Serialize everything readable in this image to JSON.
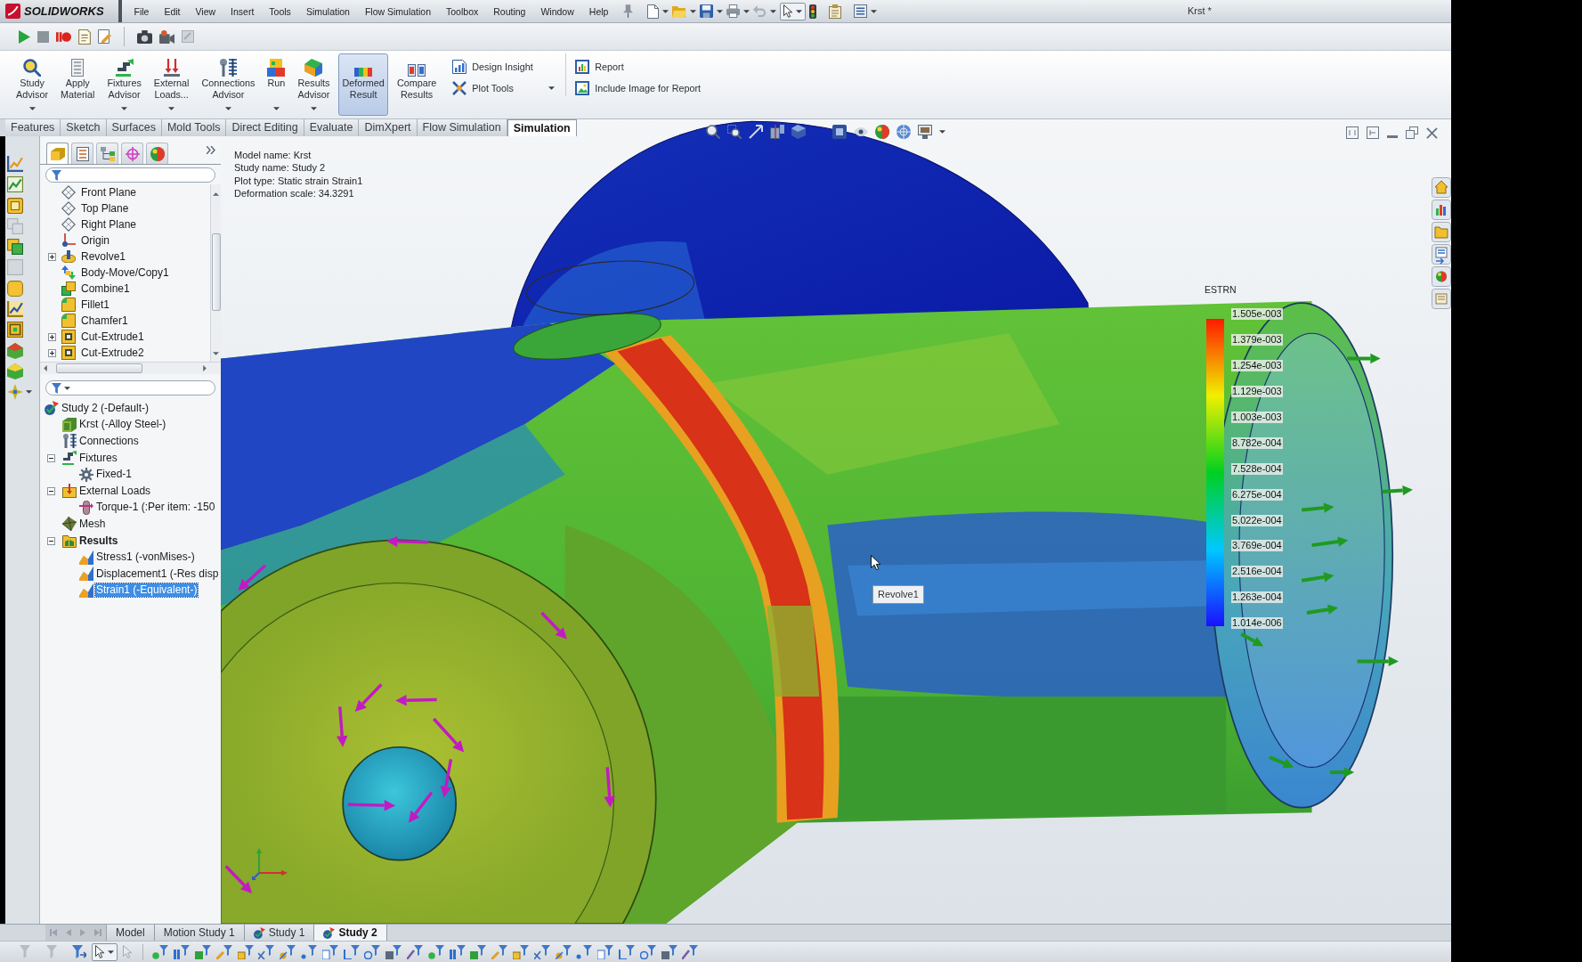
{
  "window": {
    "app_name": "SOLIDWORKS",
    "title": "Krst *"
  },
  "menu": [
    "File",
    "Edit",
    "View",
    "Insert",
    "Tools",
    "Simulation",
    "Flow Simulation",
    "Toolbox",
    "Routing",
    "Window",
    "Help"
  ],
  "command_manager": {
    "large_buttons": [
      {
        "label": "Study Advisor",
        "has_menu": true,
        "selected": false
      },
      {
        "label": "Apply Material",
        "has_menu": false,
        "selected": false
      },
      {
        "label": "Fixtures Advisor",
        "has_menu": true,
        "selected": false
      },
      {
        "label": "External Loads...",
        "has_menu": true,
        "selected": false
      },
      {
        "label": "Connections Advisor",
        "has_menu": true,
        "selected": false
      },
      {
        "label": "Run",
        "has_menu": true,
        "selected": false
      },
      {
        "label": "Results Advisor",
        "has_menu": true,
        "selected": false
      },
      {
        "label": "Deformed Result",
        "has_menu": false,
        "selected": true
      },
      {
        "label": "Compare Results",
        "has_menu": false,
        "selected": false
      }
    ],
    "small_groups": [
      [
        {
          "label": "Design Insight",
          "has_menu": false
        },
        {
          "label": "Plot Tools",
          "has_menu": true
        }
      ],
      [
        {
          "label": "Report",
          "has_menu": false
        },
        {
          "label": "Include Image for Report",
          "has_menu": false
        }
      ]
    ]
  },
  "tabs": [
    {
      "label": "Features",
      "selected": false
    },
    {
      "label": "Sketch",
      "selected": false
    },
    {
      "label": "Surfaces",
      "selected": false
    },
    {
      "label": "Mold Tools",
      "selected": false
    },
    {
      "label": "Direct Editing",
      "selected": false
    },
    {
      "label": "Evaluate",
      "selected": false
    },
    {
      "label": "DimXpert",
      "selected": false
    },
    {
      "label": "Flow Simulation",
      "selected": false
    },
    {
      "label": "Simulation",
      "selected": true
    }
  ],
  "panel_tabs": [
    {
      "kind": "features",
      "selected": true
    },
    {
      "kind": "properties",
      "selected": false
    },
    {
      "kind": "configurations",
      "selected": false
    },
    {
      "kind": "dimxpert",
      "selected": false
    },
    {
      "kind": "display",
      "selected": false
    }
  ],
  "feature_tree": [
    {
      "label": "Front Plane",
      "kind": "plane"
    },
    {
      "label": "Top Plane",
      "kind": "plane"
    },
    {
      "label": "Right Plane",
      "kind": "plane"
    },
    {
      "label": "Origin",
      "kind": "origin"
    },
    {
      "label": "Revolve1",
      "kind": "revolve",
      "expanded": false
    },
    {
      "label": "Body-Move/Copy1",
      "kind": "move"
    },
    {
      "label": "Combine1",
      "kind": "combine"
    },
    {
      "label": "Fillet1",
      "kind": "fillet"
    },
    {
      "label": "Chamfer1",
      "kind": "fillet"
    },
    {
      "label": "Cut-Extrude1",
      "kind": "cut",
      "expanded": false
    },
    {
      "label": "Cut-Extrude2",
      "kind": "cut",
      "expanded": false
    }
  ],
  "study_tree": {
    "label": "Study 2 (-Default-)",
    "kind": "study",
    "selected": false,
    "children": [
      {
        "label": "Krst (-Alloy Steel-)",
        "kind": "part",
        "selected": false
      },
      {
        "label": "Connections",
        "kind": "connections",
        "selected": false
      },
      {
        "label": "Fixtures",
        "kind": "fixtures",
        "selected": false,
        "expanded": true,
        "children": [
          {
            "label": "Fixed-1",
            "kind": "fixed",
            "selected": false
          }
        ]
      },
      {
        "label": "External Loads",
        "kind": "loads",
        "selected": false,
        "expanded": true,
        "children": [
          {
            "label": "Torque-1 (:Per item: -150",
            "kind": "torque",
            "selected": false
          }
        ]
      },
      {
        "label": "Mesh",
        "kind": "mesh",
        "selected": false
      },
      {
        "label": "Results",
        "kind": "results",
        "selected": false,
        "expanded": true,
        "children": [
          {
            "label": "Stress1 (-vonMises-)",
            "kind": "plot",
            "selected": false
          },
          {
            "label": "Displacement1 (-Res disp",
            "kind": "plot",
            "selected": false
          },
          {
            "label": "Strain1 (-Equivalent-)",
            "kind": "plot",
            "selected": true
          }
        ]
      }
    ]
  },
  "graphics": {
    "info": [
      "Model name: Krst",
      "Study name: Study 2",
      "Plot type: Static strain Strain1",
      "Deformation scale: 34.3291"
    ],
    "legend": {
      "title": "ESTRN",
      "labels": [
        "1.505e-003",
        "1.379e-003",
        "1.254e-003",
        "1.129e-003",
        "1.003e-003",
        "8.782e-004",
        "7.528e-004",
        "6.275e-004",
        "5.022e-004",
        "3.769e-004",
        "2.516e-004",
        "1.263e-004",
        "1.014e-006"
      ]
    },
    "tooltip": "Revolve1"
  },
  "bottom_tabs": [
    {
      "label": "Model",
      "kind": "model",
      "selected": false
    },
    {
      "label": "Motion Study 1",
      "kind": "motion",
      "selected": false
    },
    {
      "label": "Study 1",
      "kind": "study",
      "selected": false
    },
    {
      "label": "Study 2",
      "kind": "study",
      "selected": true
    }
  ]
}
